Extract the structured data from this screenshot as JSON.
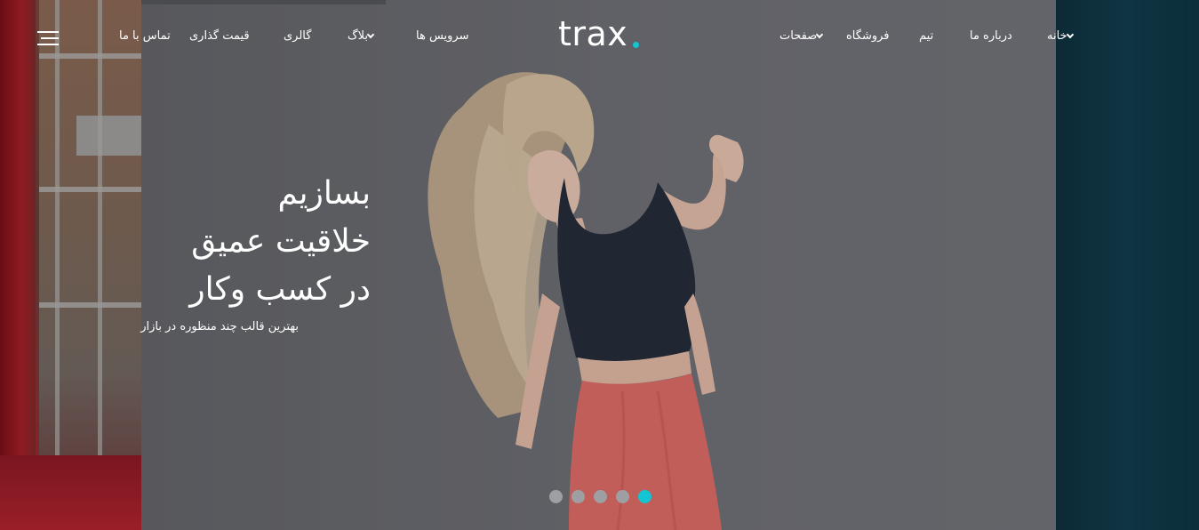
{
  "brand": {
    "logo_text": "trax",
    "accent_color": "#13c5d2"
  },
  "nav": {
    "items": [
      {
        "label": "خانه",
        "has_dropdown": true
      },
      {
        "label": "درباره ما",
        "has_dropdown": false
      },
      {
        "label": "تیم",
        "has_dropdown": false
      },
      {
        "label": "فروشگاه",
        "has_dropdown": false
      },
      {
        "label": "صفحات",
        "has_dropdown": true
      },
      {
        "label": "سرویس ها",
        "has_dropdown": false
      },
      {
        "label": "بلاگ",
        "has_dropdown": true
      },
      {
        "label": "گالری",
        "has_dropdown": false
      },
      {
        "label": "قیمت گذاری",
        "has_dropdown": false
      },
      {
        "label": "تماس با ما",
        "has_dropdown": false
      }
    ],
    "menu_icon": "hamburger-menu-icon"
  },
  "hero": {
    "line1": "بسازیم",
    "line2": "خلاقیت عمیق",
    "line3": "در کسب وکار",
    "subtitle": "بهترین قالب چند منظوره در بازار"
  },
  "slider": {
    "total": 5,
    "active_index": 4
  }
}
